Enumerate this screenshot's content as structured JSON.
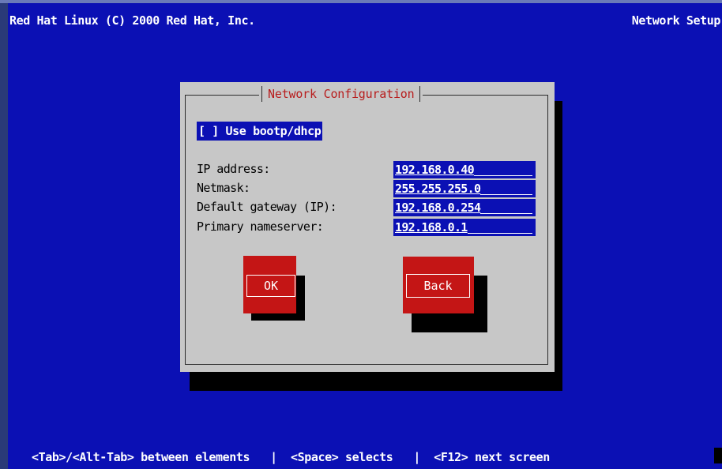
{
  "header": {
    "left_text": "Red Hat Linux (C) 2000 Red Hat, Inc.",
    "right_text": "Network Setup"
  },
  "dialog": {
    "title": "Network Configuration",
    "checkbox": {
      "mark": "[ ]",
      "label": "Use bootp/dhcp",
      "checked": false
    },
    "fields": [
      {
        "label": "IP address:",
        "value": "192.168.0.40"
      },
      {
        "label": "Netmask:",
        "value": "255.255.255.0"
      },
      {
        "label": "Default gateway (IP):",
        "value": "192.168.0.254"
      },
      {
        "label": "Primary nameserver:",
        "value": "192.168.0.1"
      }
    ],
    "buttons": {
      "ok_label": "OK",
      "back_label": "Back"
    }
  },
  "footer": {
    "help_text": "<Tab>/<Alt-Tab> between elements   |  <Space> selects   |  <F12> next screen"
  },
  "colors": {
    "screen_background": "#0b10b4",
    "dialog_background": "#c7c7c7",
    "title_text": "#b81d1d",
    "button_background": "#c41515",
    "shadow": "#000000"
  }
}
